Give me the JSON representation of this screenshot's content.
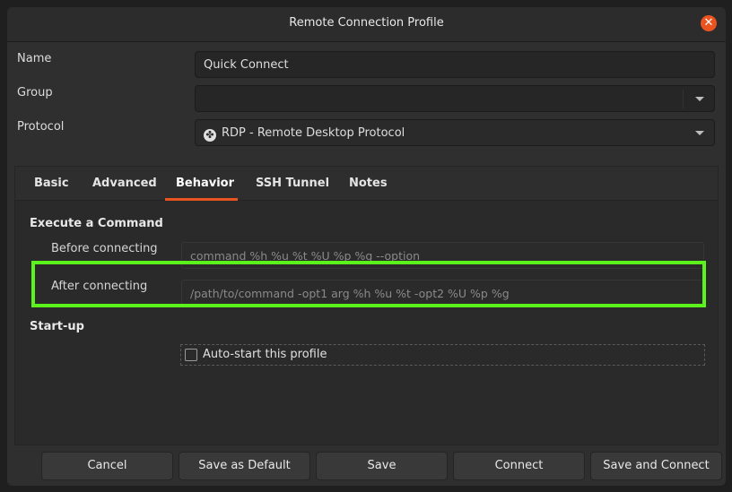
{
  "window": {
    "title": "Remote Connection Profile",
    "close_glyph": "✕"
  },
  "form": {
    "name_label": "Name",
    "name_value": "Quick Connect",
    "group_label": "Group",
    "group_value": "",
    "protocol_label": "Protocol",
    "protocol_value": "RDP - Remote Desktop Protocol",
    "protocol_icon": "✤"
  },
  "tabs": [
    {
      "label": "Basic"
    },
    {
      "label": "Advanced"
    },
    {
      "label": "Behavior"
    },
    {
      "label": "SSH Tunnel"
    },
    {
      "label": "Notes"
    }
  ],
  "active_tab": "Behavior",
  "behavior": {
    "execute_title": "Execute a Command",
    "before_label": "Before connecting",
    "before_placeholder": "command %h %u %t %U %p %g --option",
    "after_label": "After connecting",
    "after_placeholder": "/path/to/command -opt1 arg %h %u %t -opt2 %U %p %g",
    "startup_title": "Start-up",
    "autostart_label": "Auto-start this profile",
    "autostart_checked": false
  },
  "buttons": {
    "cancel": "Cancel",
    "save_default": "Save as Default",
    "save": "Save",
    "connect": "Connect",
    "save_connect": "Save and Connect"
  },
  "colors": {
    "accent": "#e95420",
    "highlight": "#5cf21b"
  }
}
